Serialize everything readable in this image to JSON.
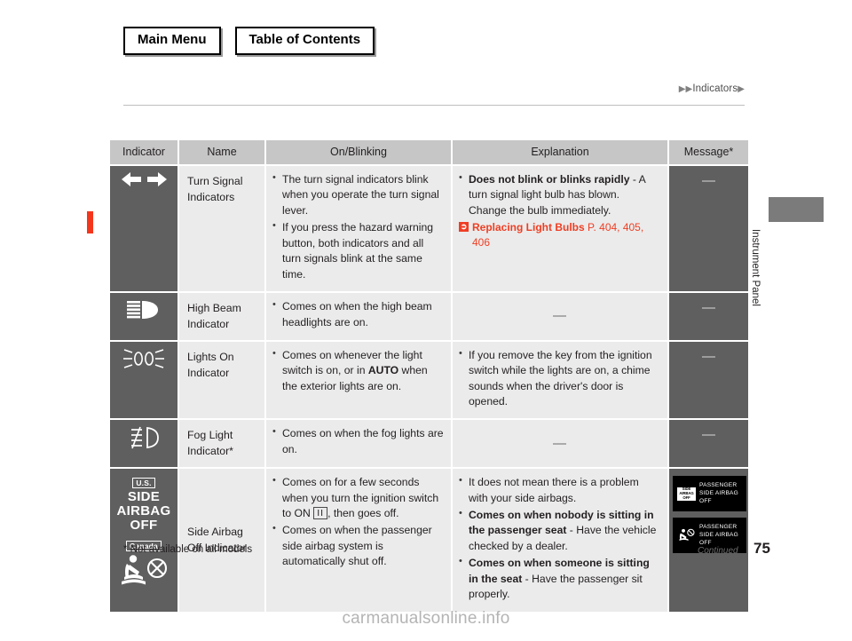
{
  "nav": {
    "buttons": [
      {
        "label": "Main Menu",
        "name": "main-menu-button"
      },
      {
        "label": "Table of Contents",
        "name": "table-of-contents-button"
      }
    ]
  },
  "breadcrumb": {
    "prefix": "▶▶",
    "label": "Indicators",
    "suffix": "▶"
  },
  "side_tab": {
    "label": "Instrument Panel"
  },
  "table": {
    "headers": [
      "Indicator",
      "Name",
      "On/Blinking",
      "Explanation",
      "Message*"
    ],
    "rows": [
      {
        "icon_name": "turn-signal-arrows-icon",
        "name": "Turn Signal Indicators",
        "on_blinking": [
          "The turn signal indicators blink when you operate the turn signal lever.",
          "If you press the hazard warning button, both indicators and all turn signals blink at the same time."
        ],
        "explanation_bold": "Does not blink or blinks rapidly",
        "explanation_rest": " - A turn signal light bulb has blown. Change the bulb immediately.",
        "ref_title": "Replacing Light Bulbs",
        "ref_pages": "P. 404, 405, 406",
        "message": "—"
      },
      {
        "icon_name": "high-beam-icon",
        "name": "High Beam Indicator",
        "on_blinking": [
          "Comes on when the high beam headlights are on."
        ],
        "explanation_dash": "—",
        "message": "—"
      },
      {
        "icon_name": "lights-on-icon",
        "name": "Lights On Indicator",
        "on_blinking_pre": "Comes on whenever the light switch is on, or in ",
        "on_blinking_bold": "AUTO",
        "on_blinking_post": " when the exterior lights are on.",
        "explanation": [
          "If you remove the key from the ignition switch while the lights are on, a chime sounds when the driver's door is opened."
        ],
        "message": "—"
      },
      {
        "icon_name": "fog-light-icon",
        "name": "Fog Light Indicator*",
        "on_blinking": [
          "Comes on when the fog lights are on."
        ],
        "explanation_dash": "—",
        "message": "—"
      },
      {
        "icon_name": "side-airbag-off-icon",
        "icon_us_tag": "U.S.",
        "icon_us_line1": "SIDE",
        "icon_us_line2": "AIRBAG",
        "icon_us_line3": "OFF",
        "icon_ca_tag": "Canada",
        "name": "Side Airbag Off Indicator",
        "on_blinking_1_pre": "Comes on for a few seconds when you turn the ignition switch to ON ",
        "on_blinking_1_key": "II",
        "on_blinking_1_post": ", then goes off.",
        "on_blinking_2": "Comes on when the passenger side airbag system is automatically shut off.",
        "explanation_1": "It does not mean there is a problem with your side airbags.",
        "explanation_2_bold": "Comes on when nobody is sitting in the passenger seat",
        "explanation_2_rest": " - Have the vehicle checked by a dealer.",
        "explanation_3_bold": "Comes on when someone is sitting in the seat",
        "explanation_3_rest": " - Have the passenger sit properly.",
        "messages": [
          {
            "badge_l1": "SIDE",
            "badge_l2": "AIRBAG",
            "badge_l3": "OFF",
            "text_l1": "PASSENGER",
            "text_l2": "SIDE AIRBAG",
            "text_l3": "OFF"
          },
          {
            "badge_icon": "occupant-airbag-off-icon",
            "text_l1": "PASSENGER",
            "text_l2": "SIDE AIRBAG",
            "text_l3": "OFF"
          }
        ]
      }
    ]
  },
  "footer": {
    "footnote": "* Not available on all models",
    "continued": "Continued",
    "page": "75"
  },
  "watermark": {
    "text": "carmanualsonline.info"
  },
  "colors": {
    "accent_red": "#ef3e23",
    "marker_red": "#f4361d",
    "icon_bg": "#5f5f5f",
    "cell_bg": "#ebebeb",
    "header_bg": "#c6c6c6"
  }
}
